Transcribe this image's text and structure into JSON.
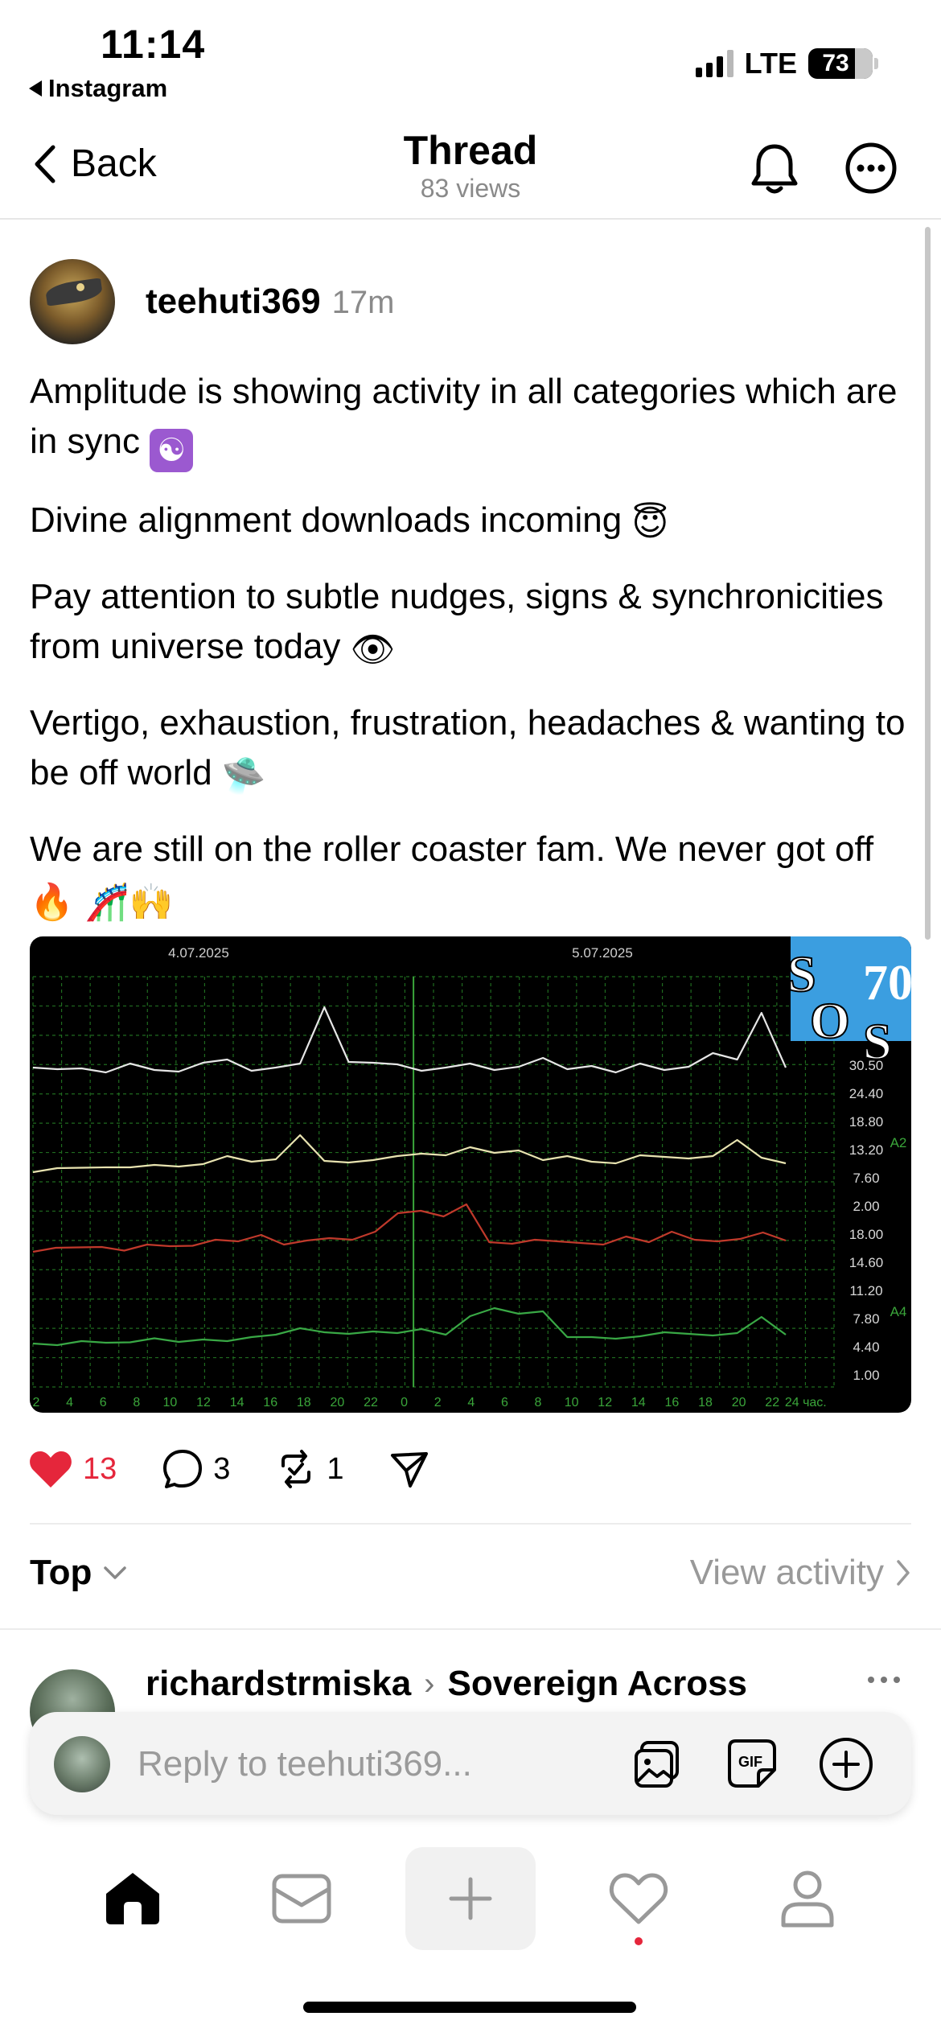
{
  "status_bar": {
    "time": "11:14",
    "back_app": "Instagram",
    "network": "LTE",
    "battery": "73"
  },
  "header": {
    "back_label": "Back",
    "title": "Thread",
    "subtitle": "83 views"
  },
  "post": {
    "author": "teehuti369",
    "time": "17m",
    "paragraphs": [
      {
        "text": "Amplitude is showing activity in all categories which are in sync",
        "emoji": "☯"
      },
      {
        "text": "Divine alignment downloads incoming",
        "emoji": "😇"
      },
      {
        "text": "Pay attention to subtle nudges, signs & synchronicities from universe today",
        "emoji": "👁"
      },
      {
        "text": "Vertigo, exhaustion, frustration, headaches & wanting to be off world",
        "emoji": "🛸"
      },
      {
        "text": "We are still on the roller coaster fam. We never got off",
        "emoji": "🔥 🎢🙌"
      }
    ],
    "likes": "13",
    "comments": "3",
    "reposts": "1"
  },
  "chart_data": {
    "type": "line",
    "dates": [
      "4.07.2025",
      "5.07.2025"
    ],
    "x_ticks": [
      "2",
      "4",
      "6",
      "8",
      "10",
      "12",
      "14",
      "16",
      "18",
      "20",
      "22",
      "0",
      "2",
      "4",
      "6",
      "8",
      "10",
      "12",
      "14",
      "16",
      "18",
      "20",
      "22",
      "24 час."
    ],
    "y_ticks": [
      "30.50",
      "24.40",
      "18.80",
      "13.20",
      "7.60",
      "2.00",
      "18.00",
      "14.60",
      "11.20",
      "7.80",
      "4.40",
      "1.00"
    ],
    "right_labels": [
      "A2",
      "A4"
    ],
    "overlay_logo": {
      "letters": [
        "S",
        "O",
        "S"
      ],
      "number": "70"
    },
    "series": [
      {
        "color": "#e6e6e6",
        "values": [
          9,
          9,
          9.5,
          9,
          10,
          9,
          9,
          10,
          11,
          9,
          10,
          10,
          22,
          11,
          10,
          10,
          9,
          10,
          10,
          9,
          10,
          11,
          9,
          10,
          9,
          10,
          9,
          10,
          12,
          11,
          21,
          10
        ]
      },
      {
        "color": "#e8e3b0",
        "values": [
          6,
          6,
          6.5,
          7,
          6,
          7,
          7,
          8,
          9,
          8,
          9,
          14,
          8,
          8,
          9,
          9,
          10,
          10,
          11,
          10,
          11,
          9,
          9,
          8,
          8,
          9,
          9,
          9,
          10,
          13,
          9,
          8
        ]
      },
      {
        "color": "#c0392b",
        "values": [
          6,
          6,
          6.5,
          7,
          6.5,
          7,
          7,
          7.5,
          8,
          8,
          10,
          8,
          8,
          9,
          9,
          10,
          15,
          16,
          15,
          17,
          8,
          8,
          8,
          8,
          8,
          8,
          9,
          8,
          11,
          8,
          8,
          9,
          11,
          8
        ]
      },
      {
        "color": "#39a845",
        "values": [
          3,
          3,
          3,
          3,
          3.5,
          3.5,
          3,
          4,
          4,
          4,
          5,
          7,
          5,
          5,
          6,
          6,
          6,
          5,
          10,
          11,
          10,
          11,
          5,
          4,
          4,
          5,
          5,
          5,
          5,
          6,
          9,
          5
        ]
      }
    ]
  },
  "sort": {
    "label": "Top",
    "view_activity": "View activity"
  },
  "reply": {
    "author": "richardstrmiska",
    "community": "Sovereign Across"
  },
  "composer": {
    "placeholder": "Reply to teehuti369..."
  },
  "colors": {
    "accent_red": "#e5263b",
    "muted": "#8a8a8a"
  }
}
